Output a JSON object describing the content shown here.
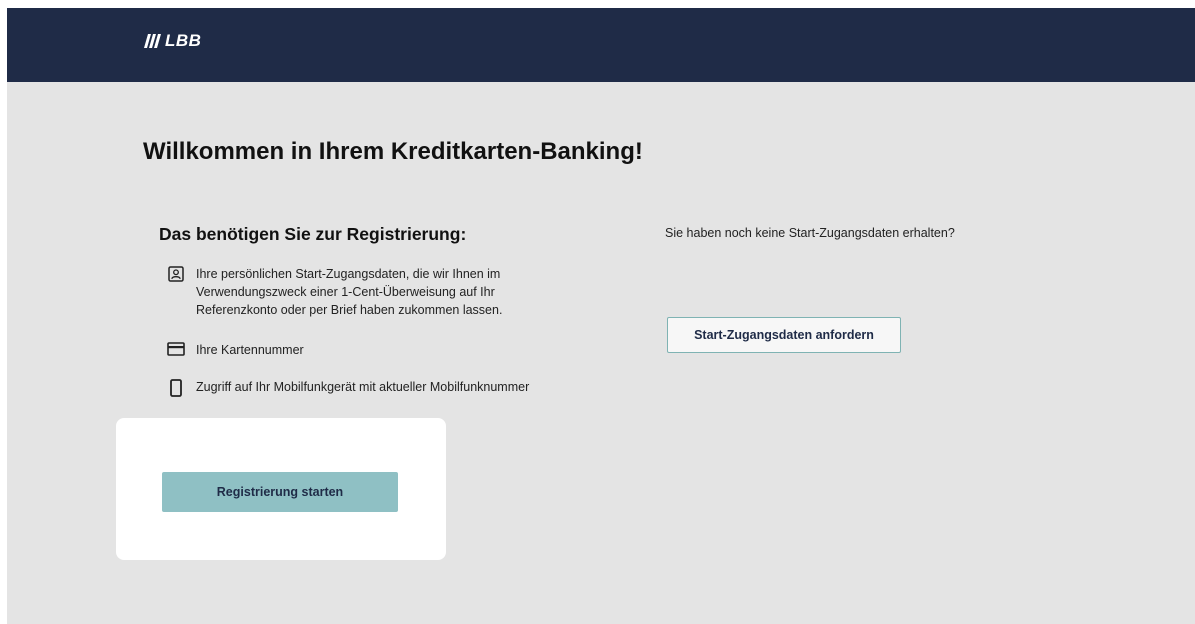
{
  "header": {
    "logo_text": "LBB",
    "background_color": "#1f2b47"
  },
  "main": {
    "title": "Willkommen in Ihrem Kreditkarten-Banking!",
    "requirements": {
      "heading": "Das benötigen Sie zur Registrierung:",
      "items": [
        {
          "icon": "id-card-icon",
          "text": "Ihre persönlichen Start-Zugangsdaten, die wir Ihnen im Verwendungszweck einer 1-Cent-Überweisung auf Ihr Referenzkonto oder per Brief haben zukommen lassen."
        },
        {
          "icon": "credit-card-icon",
          "text": "Ihre Kartennummer"
        },
        {
          "icon": "mobile-phone-icon",
          "text": "Zugriff auf Ihr Mobilfunkgerät mit aktueller Mobilfunknummer"
        }
      ]
    },
    "no_credentials": {
      "question": "Sie haben noch keine Start-Zugangsdaten erhalten?",
      "button_label": "Start-Zugangsdaten anfordern"
    },
    "start_card": {
      "button_label": "Registrierung starten",
      "button_color": "#8fc0c4"
    }
  }
}
